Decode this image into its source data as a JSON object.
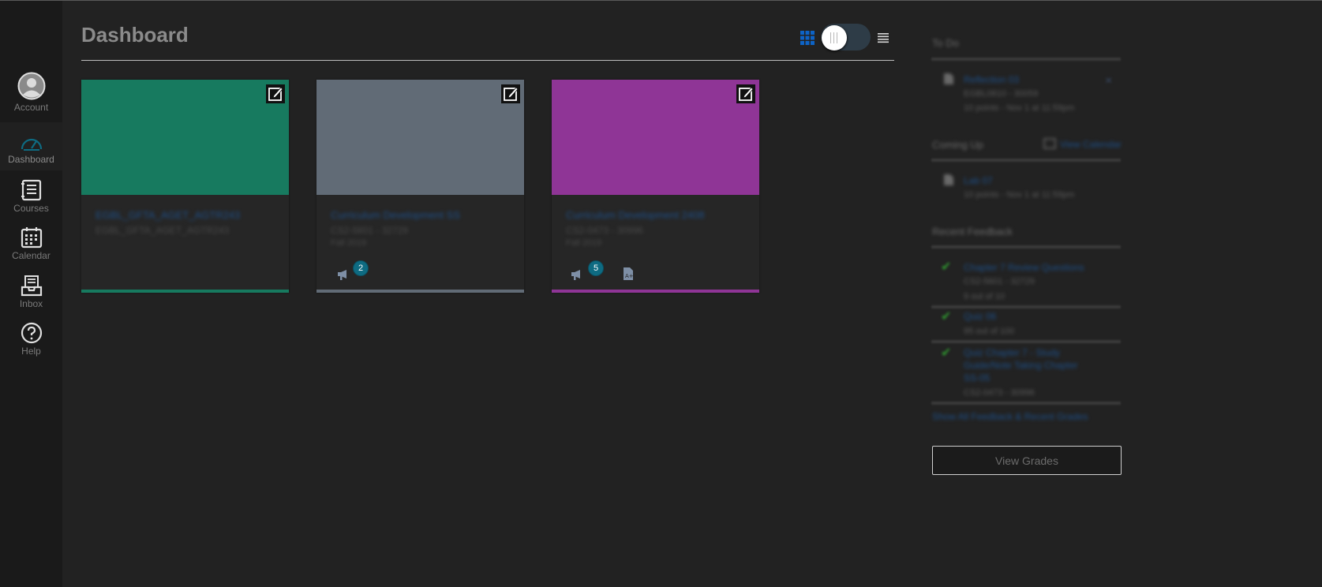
{
  "nav": {
    "items": [
      {
        "label": "Account",
        "icon": "avatar-icon"
      },
      {
        "label": "Dashboard",
        "icon": "dashboard-gauge-icon"
      },
      {
        "label": "Courses",
        "icon": "courses-book-icon"
      },
      {
        "label": "Calendar",
        "icon": "calendar-icon"
      },
      {
        "label": "Inbox",
        "icon": "inbox-icon"
      },
      {
        "label": "Help",
        "icon": "help-icon"
      }
    ],
    "active": "Dashboard",
    "accent": "#0e6b82"
  },
  "header": {
    "title": "Dashboard",
    "view_toggle": {
      "left_icon": "grid-view-icon",
      "right_icon": "list-view-icon"
    }
  },
  "cards": [
    {
      "name": "EGBL_GFTA_AGET_AGTR243",
      "sub1": "EGBL_GFTA_AGET_AGTR243",
      "sub2": "",
      "color": "#177a5f",
      "badges": []
    },
    {
      "name": "Curriculum Development SS",
      "sub1": "CS2-5601 - 32729",
      "sub2": "Fall 2019",
      "color": "#616b76",
      "badges": [
        {
          "icon": "announcement-icon",
          "count": "2"
        }
      ]
    },
    {
      "name": "Curriculum Development 2408",
      "sub1": "CS2-0473 - 30996",
      "sub2": "Fall 2019",
      "color": "#8f3596",
      "badges": [
        {
          "icon": "announcement-icon",
          "count": "5"
        },
        {
          "icon": "assignment-icon",
          "count": ""
        }
      ]
    }
  ],
  "sidebar": {
    "todo_title": "To Do",
    "todo_item": {
      "title": "Reflection 03",
      "line1": "EGBL0810 - 30059",
      "line2": "10 points - Nov 1 at 11:59pm"
    },
    "coming_up_title": "Coming Up",
    "view_calendar": "View Calendar",
    "coming_item": {
      "title": "Lab 07",
      "line1": "10 points - Nov 1 at 11:59pm"
    },
    "feedback_title": "Recent Feedback",
    "feedback": [
      {
        "title": "Chapter 7 Review Questions",
        "line1": "CS2-5601 - 32729",
        "line2": "9 out of 10"
      },
      {
        "title": "Quiz 06",
        "line1": "95 out of 100",
        "line2": ""
      },
      {
        "title": "Quiz Chapter 7 - Study",
        "line1": "Guide/Note Taking Chapter",
        "line2": "SS-05",
        "line3": "CS2-0473 - 30996"
      }
    ],
    "show_all": "Show All Feedback & Recent Grades",
    "view_grades": "View Grades"
  }
}
